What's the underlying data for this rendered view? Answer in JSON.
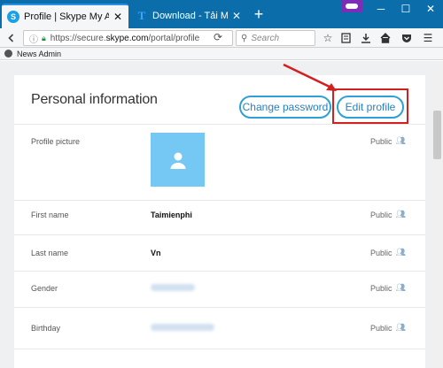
{
  "browser": {
    "tabs": [
      {
        "title": "Profile | Skype My Account",
        "favicon": "skype-icon",
        "active": true
      },
      {
        "title": "Download - Tải Miễn Phí ...",
        "favicon": "t-letter-icon",
        "active": false
      }
    ],
    "new_tab_label": "+",
    "url_prefix": "https://secure.",
    "url_domain": "skype.com",
    "url_path": "/portal/profile",
    "search_placeholder": "Search",
    "bookmark_label": "News Admin",
    "accent_color": "#0b6eaa"
  },
  "profile": {
    "heading": "Personal information",
    "change_password_label": "Change password",
    "edit_profile_label": "Edit profile",
    "fields": [
      {
        "label": "Profile picture",
        "value": "",
        "privacy": "Public"
      },
      {
        "label": "First name",
        "value": "Taimienphi",
        "privacy": "Public"
      },
      {
        "label": "Last name",
        "value": "Vn",
        "privacy": "Public"
      },
      {
        "label": "Gender",
        "value": "",
        "privacy": "Public"
      },
      {
        "label": "Birthday",
        "value": "",
        "privacy": "Public"
      }
    ],
    "button_color": "#2fa0d6",
    "highlight_color": "#d21f1f"
  }
}
